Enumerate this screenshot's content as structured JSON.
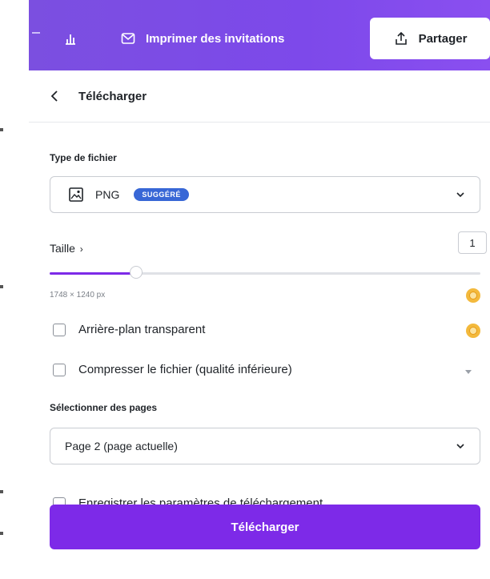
{
  "topbar": {
    "print_label": "Imprimer des invitations",
    "share_label": "Partager",
    "colors": {
      "bar": "#7d49ea"
    }
  },
  "panel": {
    "title": "Télécharger",
    "file_type": {
      "label": "Type de fichier",
      "selected": "PNG",
      "badge": "SUGGÉRÉ"
    },
    "size": {
      "label": "Taille",
      "value": "1",
      "slider_value": 0.2,
      "dimensions": "1748 × 1240 px"
    },
    "options": [
      {
        "label": "Arrière-plan transparent",
        "checked": false
      },
      {
        "label": "Compresser le fichier (qualité inférieure)",
        "checked": false
      }
    ],
    "pages": {
      "label": "Sélectionner des pages",
      "selected": "Page 2 (page actuelle)"
    },
    "save_settings": {
      "label": "Enregistrer les paramètres de téléchargement",
      "checked": false
    },
    "download_button": "Télécharger",
    "accent": "#7d2ae8",
    "pro_color": "#f3b93c"
  }
}
